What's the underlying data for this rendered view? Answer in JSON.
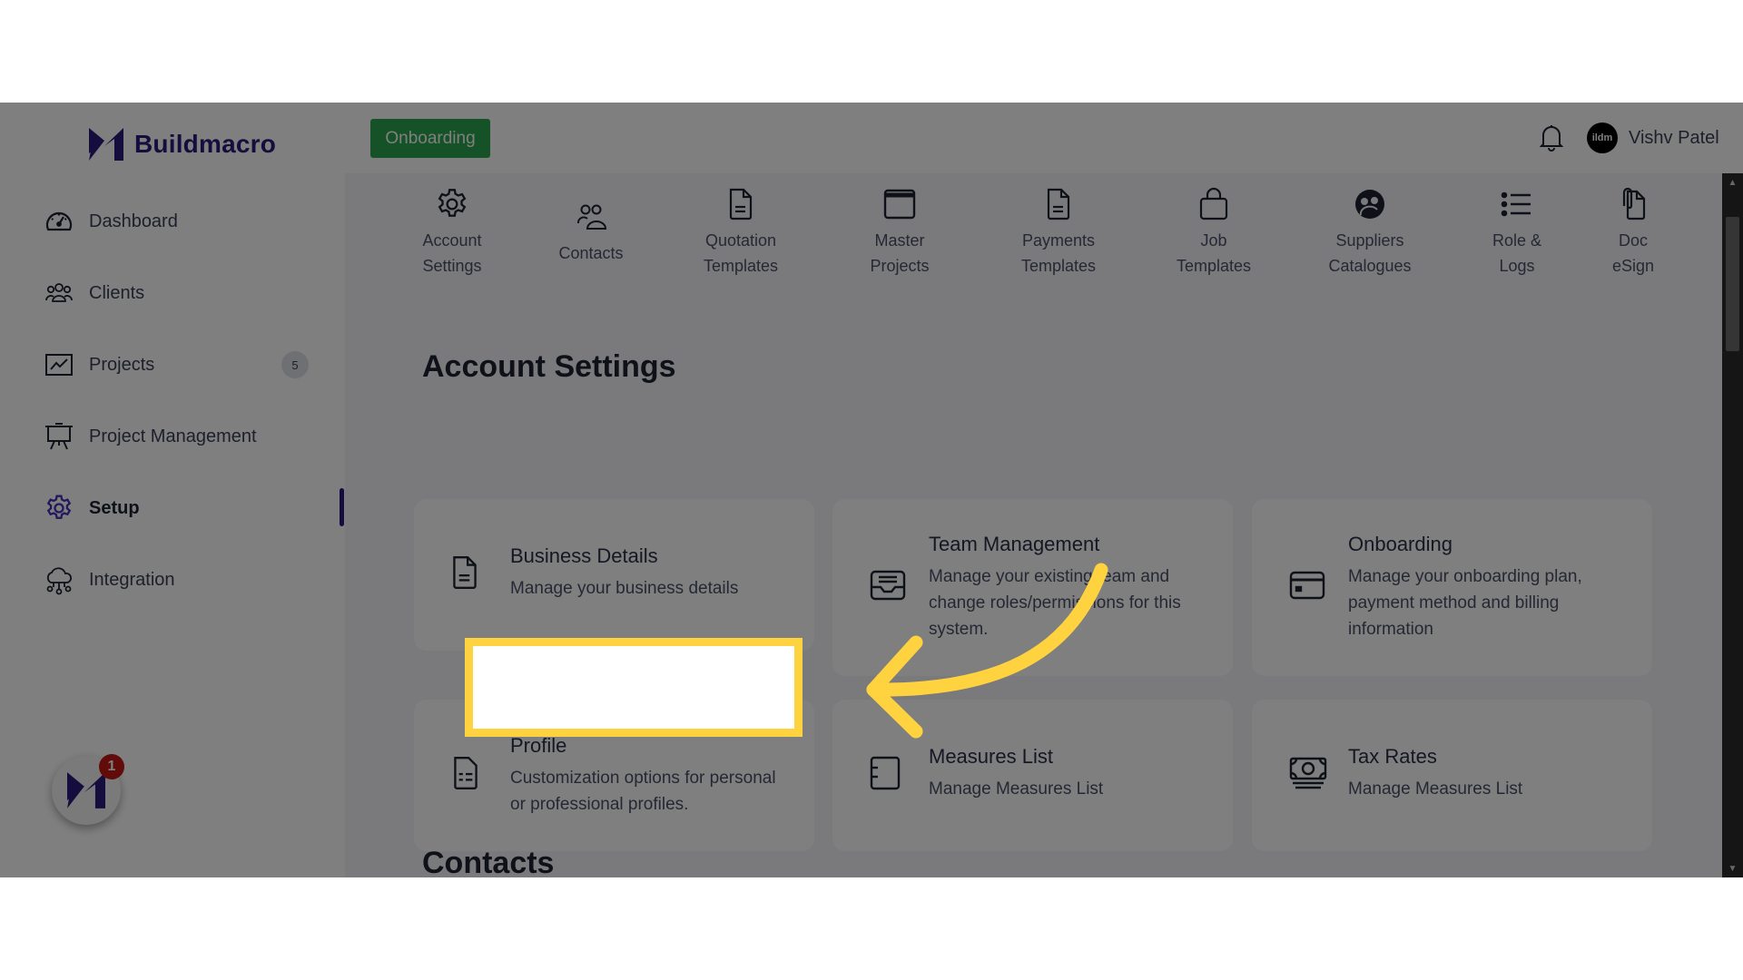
{
  "app": {
    "brand": "Buildmacro",
    "onboarding_button": "Onboarding",
    "user_name": "Vishv Patel",
    "avatar_text": "ildm"
  },
  "sidebar": {
    "items": [
      {
        "label": "Dashboard",
        "icon": "speedometer-icon"
      },
      {
        "label": "Clients",
        "icon": "users-group-icon"
      },
      {
        "label": "Projects",
        "icon": "chart-line-icon",
        "badge": "5"
      },
      {
        "label": "Project Management",
        "icon": "presentation-board-icon"
      },
      {
        "label": "Setup",
        "icon": "gear-icon",
        "active": true
      },
      {
        "label": "Integration",
        "icon": "cloud-network-icon"
      }
    ],
    "fab_badge": "1"
  },
  "tabs": [
    {
      "line1": "Account",
      "line2": "Settings",
      "icon": "gear-icon"
    },
    {
      "line1": "Contacts",
      "line2": "",
      "icon": "contacts-icon"
    },
    {
      "line1": "Quotation",
      "line2": "Templates",
      "icon": "document-icon"
    },
    {
      "line1": "Master",
      "line2": "Projects",
      "icon": "window-icon"
    },
    {
      "line1": "Payments",
      "line2": "Templates",
      "icon": "document-icon"
    },
    {
      "line1": "Job",
      "line2": "Templates",
      "icon": "shopping-bag-icon"
    },
    {
      "line1": "Suppliers",
      "line2": "Catalogues",
      "icon": "supplier-icon"
    },
    {
      "line1": "Role &",
      "line2": "Logs",
      "icon": "list-icon"
    },
    {
      "line1": "Doc",
      "line2": "eSign",
      "icon": "clip-document-icon"
    }
  ],
  "sections": {
    "account_settings": {
      "title": "Account Settings",
      "cards": [
        {
          "title": "Business Details",
          "desc": "Manage your business details",
          "icon": "document-icon"
        },
        {
          "title": "Team Management",
          "desc": "Manage your existing team and change roles/permissions for this system.",
          "icon": "inbox-tray-icon"
        },
        {
          "title": "Onboarding",
          "desc": "Manage your onboarding plan, payment method and billing information",
          "icon": "credit-card-icon"
        },
        {
          "title": "Profile",
          "desc": "Customization options for personal or professional profiles.",
          "icon": "id-document-icon"
        },
        {
          "title": "Measures List",
          "desc": "Manage Measures List",
          "icon": "ruler-box-icon"
        },
        {
          "title": "Tax Rates",
          "desc": "Manage Measures List",
          "icon": "money-stack-icon"
        }
      ]
    },
    "contacts": {
      "title": "Contacts"
    }
  },
  "annotation": {
    "highlight_color": "#ffd23f",
    "arrow_color": "#ffd23f",
    "target": "Profile card"
  },
  "colors": {
    "brand": "#2a1a7a",
    "onboarding_green": "#2da44e",
    "notification_red": "#c41616"
  }
}
